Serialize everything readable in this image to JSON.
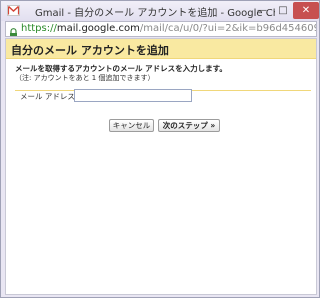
{
  "window": {
    "title": "Gmail - 自分のメール アカウントを追加 - Google Chrome",
    "controls": {
      "minimize": "—",
      "maximize": "□",
      "close": "✕"
    }
  },
  "addressbar": {
    "url_secure": "https://",
    "url_host": "mail.google.com",
    "url_path": "/mail/ca/u/0/?ui=2&ik=b96d454609&view"
  },
  "dialog": {
    "title": "自分のメール アカウントを追加",
    "instruction": "メールを取得するアカウントのメール アドレスを入力します。",
    "note": "（注: アカウントをあと 1 個追加できます）",
    "email_label": "メール アドレス:",
    "email_value": "",
    "cancel_label": "キャンセル",
    "next_label": "次のステップ »"
  },
  "colors": {
    "header_bg": "#f9e9a1",
    "secure_green": "#2a8a2a",
    "close_red": "#c75050",
    "gmail_red": "#d44638"
  },
  "icons": {
    "app": "gmail-envelope-icon",
    "lock": "lock-icon"
  }
}
